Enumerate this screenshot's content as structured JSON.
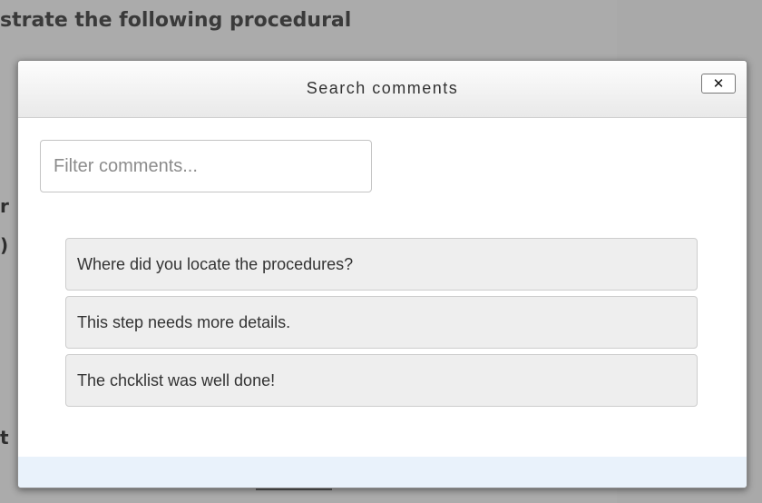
{
  "background": {
    "heading": "strate the following procedural",
    "fragments": [
      "r",
      ")",
      "t"
    ]
  },
  "dialog": {
    "title": "Search comments",
    "close_label": "✕",
    "filter": {
      "placeholder": "Filter comments...",
      "value": ""
    },
    "comments": [
      "Where did you locate the procedures?",
      "This step needs more details.",
      "The chcklist was well done!"
    ]
  }
}
